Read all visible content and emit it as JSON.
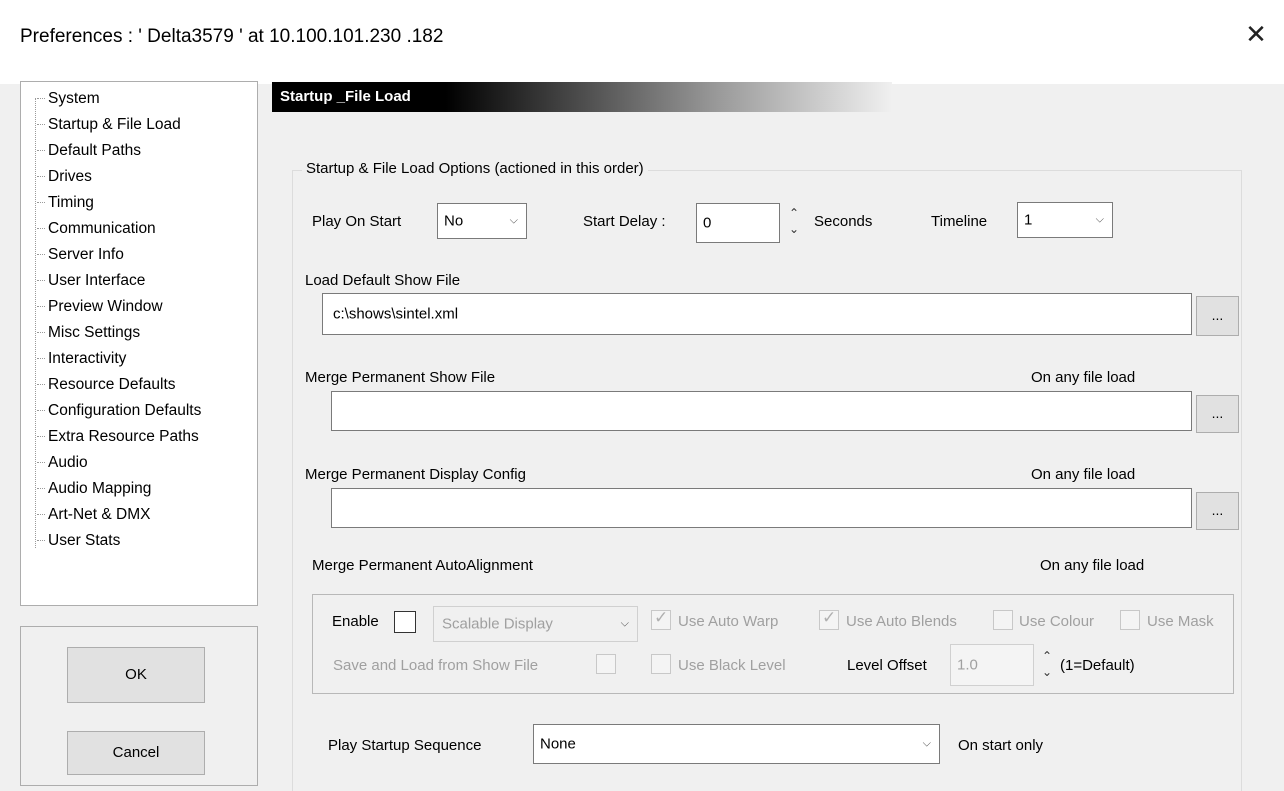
{
  "window": {
    "title": "Preferences  :  ' Delta3579 ' at 10.100.101.230  .182",
    "close_glyph": "✕"
  },
  "tree": {
    "items": [
      "System",
      "Startup & File Load",
      "Default Paths",
      "Drives",
      "Timing",
      "Communication",
      "Server Info",
      "User Interface",
      "Preview Window",
      "Misc Settings",
      "Interactivity",
      "Resource Defaults",
      "Configuration Defaults",
      "Extra Resource Paths",
      "Audio",
      "Audio Mapping",
      "Art-Net & DMX",
      "User Stats"
    ]
  },
  "buttons": {
    "ok": "OK",
    "cancel": "Cancel",
    "browse": "..."
  },
  "header": {
    "title": "Startup _File Load"
  },
  "options": {
    "group_label": "Startup & File Load Options (actioned in this order)",
    "play_on_start_label": "Play On Start",
    "play_on_start_value": "No",
    "start_delay_label": "Start Delay :",
    "start_delay_value": "0",
    "seconds_label": "Seconds",
    "timeline_label": "Timeline",
    "timeline_value": "1",
    "load_default_label": "Load Default Show File",
    "load_default_value": "c:\\shows\\sintel.xml",
    "merge_show_label": "Merge Permanent Show File",
    "merge_show_note": "On any file load",
    "merge_show_value": "",
    "merge_display_label": "Merge Permanent Display Config",
    "merge_display_note": "On any file load",
    "merge_display_value": "",
    "merge_align_label": "Merge Permanent AutoAlignment",
    "merge_align_note": "On any file load"
  },
  "autoalign": {
    "enable_label": "Enable",
    "display_type": "Scalable Display",
    "use_auto_warp": "Use Auto Warp",
    "use_auto_blends": "Use Auto Blends",
    "use_colour": "Use Colour",
    "use_mask": "Use Mask",
    "save_load_label": "Save and Load from Show File",
    "use_black_level": "Use Black Level",
    "level_offset_label": "Level Offset",
    "level_offset_value": "1.0",
    "level_offset_hint": "(1=Default)"
  },
  "startup_sequence": {
    "label": "Play Startup Sequence",
    "value": "None",
    "note": "On start only"
  }
}
